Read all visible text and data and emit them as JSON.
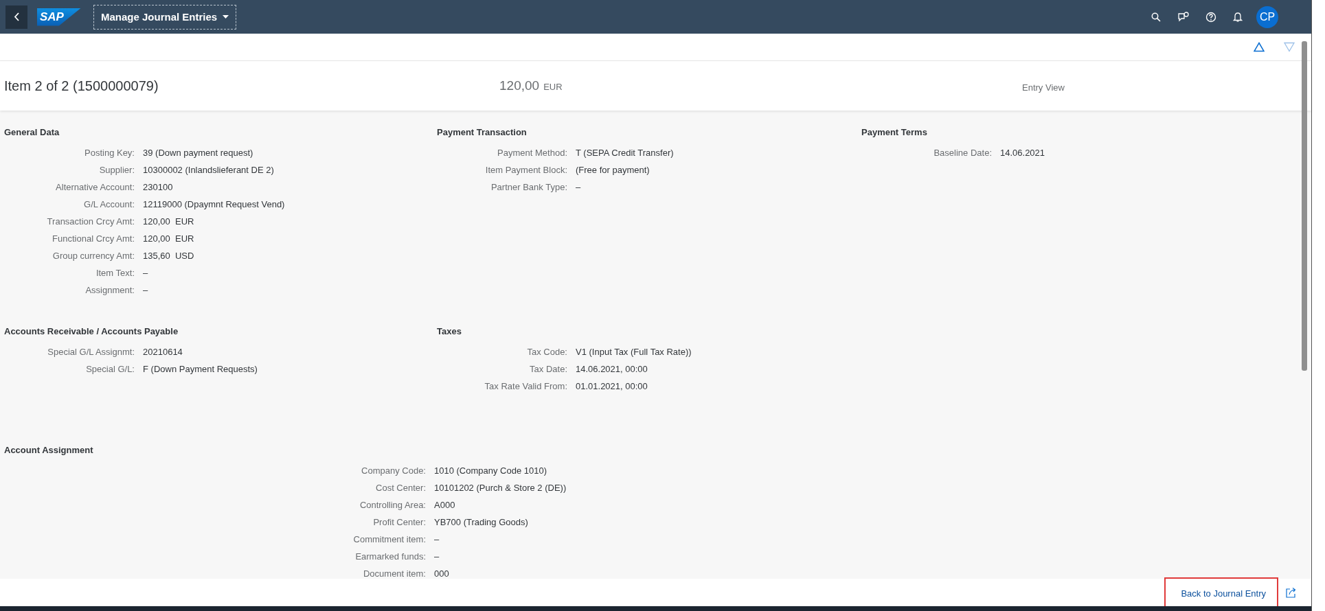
{
  "shell": {
    "logo": "SAP",
    "app_title": "Manage Journal Entries",
    "avatar": "CP"
  },
  "header": {
    "title": "Item 2 of 2 (1500000079)",
    "amount": "120,00",
    "currency": "EUR",
    "view": "Entry View"
  },
  "sections": [
    {
      "kind": "column",
      "title": "General Data",
      "fields": [
        {
          "label": "Posting Key:",
          "value": "39 (Down payment request)"
        },
        {
          "label": "Supplier:",
          "value": "10300002 (Inlandslieferant DE 2)"
        },
        {
          "label": "Alternative Account:",
          "value": "230100"
        },
        {
          "label": "G/L Account:",
          "value": "12119000 (Dpaymnt Request Vend)"
        },
        {
          "label": "Transaction Crcy Amt:",
          "value": "120,00  EUR"
        },
        {
          "label": "Functional Crcy Amt:",
          "value": "120,00  EUR"
        },
        {
          "label": "Group currency Amt:",
          "value": "135,60  USD"
        },
        {
          "label": "Item Text:",
          "value": "–"
        },
        {
          "label": "Assignment:",
          "value": "–"
        }
      ]
    },
    {
      "kind": "column",
      "title": "Payment Transaction",
      "fields": [
        {
          "label": "Payment Method:",
          "value": "T (SEPA Credit Transfer)"
        },
        {
          "label": "Item Payment Block:",
          "value": "(Free for payment)"
        },
        {
          "label": "Partner Bank Type:",
          "value": "–"
        }
      ]
    },
    {
      "kind": "column",
      "title": "Payment Terms",
      "fields": [
        {
          "label": "Baseline Date:",
          "value": "14.06.2021"
        }
      ]
    },
    {
      "kind": "column",
      "title": "Accounts Receivable / Accounts Payable",
      "fields": [
        {
          "label": "Special G/L Assignmt:",
          "value": "20210614"
        },
        {
          "label": "Special G/L:",
          "value": "F (Down Payment Requests)"
        }
      ]
    },
    {
      "kind": "column",
      "title": "Taxes",
      "fields": [
        {
          "label": "Tax Code:",
          "value": "V1 (Input Tax (Full Tax Rate))"
        },
        {
          "label": "Tax Date:",
          "value": "14.06.2021, 00:00"
        },
        {
          "label": "Tax Rate Valid From:",
          "value": "01.01.2021, 00:00"
        }
      ]
    },
    {
      "kind": "wide",
      "title": "Account Assignment",
      "fields": [
        {
          "label": "Company Code:",
          "value": "1010 (Company Code 1010)"
        },
        {
          "label": "Cost Center:",
          "value": "10101202 (Purch & Store 2 (DE))"
        },
        {
          "label": "Controlling Area:",
          "value": "A000"
        },
        {
          "label": "Profit Center:",
          "value": "YB700 (Trading Goods)"
        },
        {
          "label": "Commitment item:",
          "value": "–"
        },
        {
          "label": "Earmarked funds:",
          "value": "–"
        },
        {
          "label": "Document item:",
          "value": "000"
        }
      ]
    }
  ],
  "footer": {
    "link": "Back to Journal Entry"
  }
}
